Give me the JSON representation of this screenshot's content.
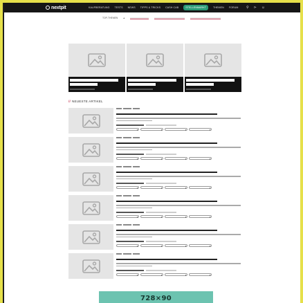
{
  "brand": {
    "name": "nextpit"
  },
  "nav": {
    "items": [
      {
        "label": "KAUFBERATUNG",
        "active": false
      },
      {
        "label": "TESTS",
        "active": false
      },
      {
        "label": "NEWS",
        "active": false
      },
      {
        "label": "TIPPS & TRICKS",
        "active": false
      },
      {
        "label": "CASH CAB",
        "active": false
      },
      {
        "label": "STELLENMARKT",
        "active": true
      },
      {
        "label": "THEMEN",
        "active": false
      },
      {
        "label": "FORUM",
        "active": false
      }
    ],
    "icons": [
      "search-icon",
      "share-icon",
      "user-icon"
    ]
  },
  "subnav": {
    "label": "TOP-THEMEN"
  },
  "section": {
    "title": "NEUESTE ARTIKEL"
  },
  "ad": {
    "label": "728×90"
  },
  "colors": {
    "accent": "#c8435e",
    "active_nav": "#2a9a75",
    "ad_bg": "#6cc3b0"
  }
}
